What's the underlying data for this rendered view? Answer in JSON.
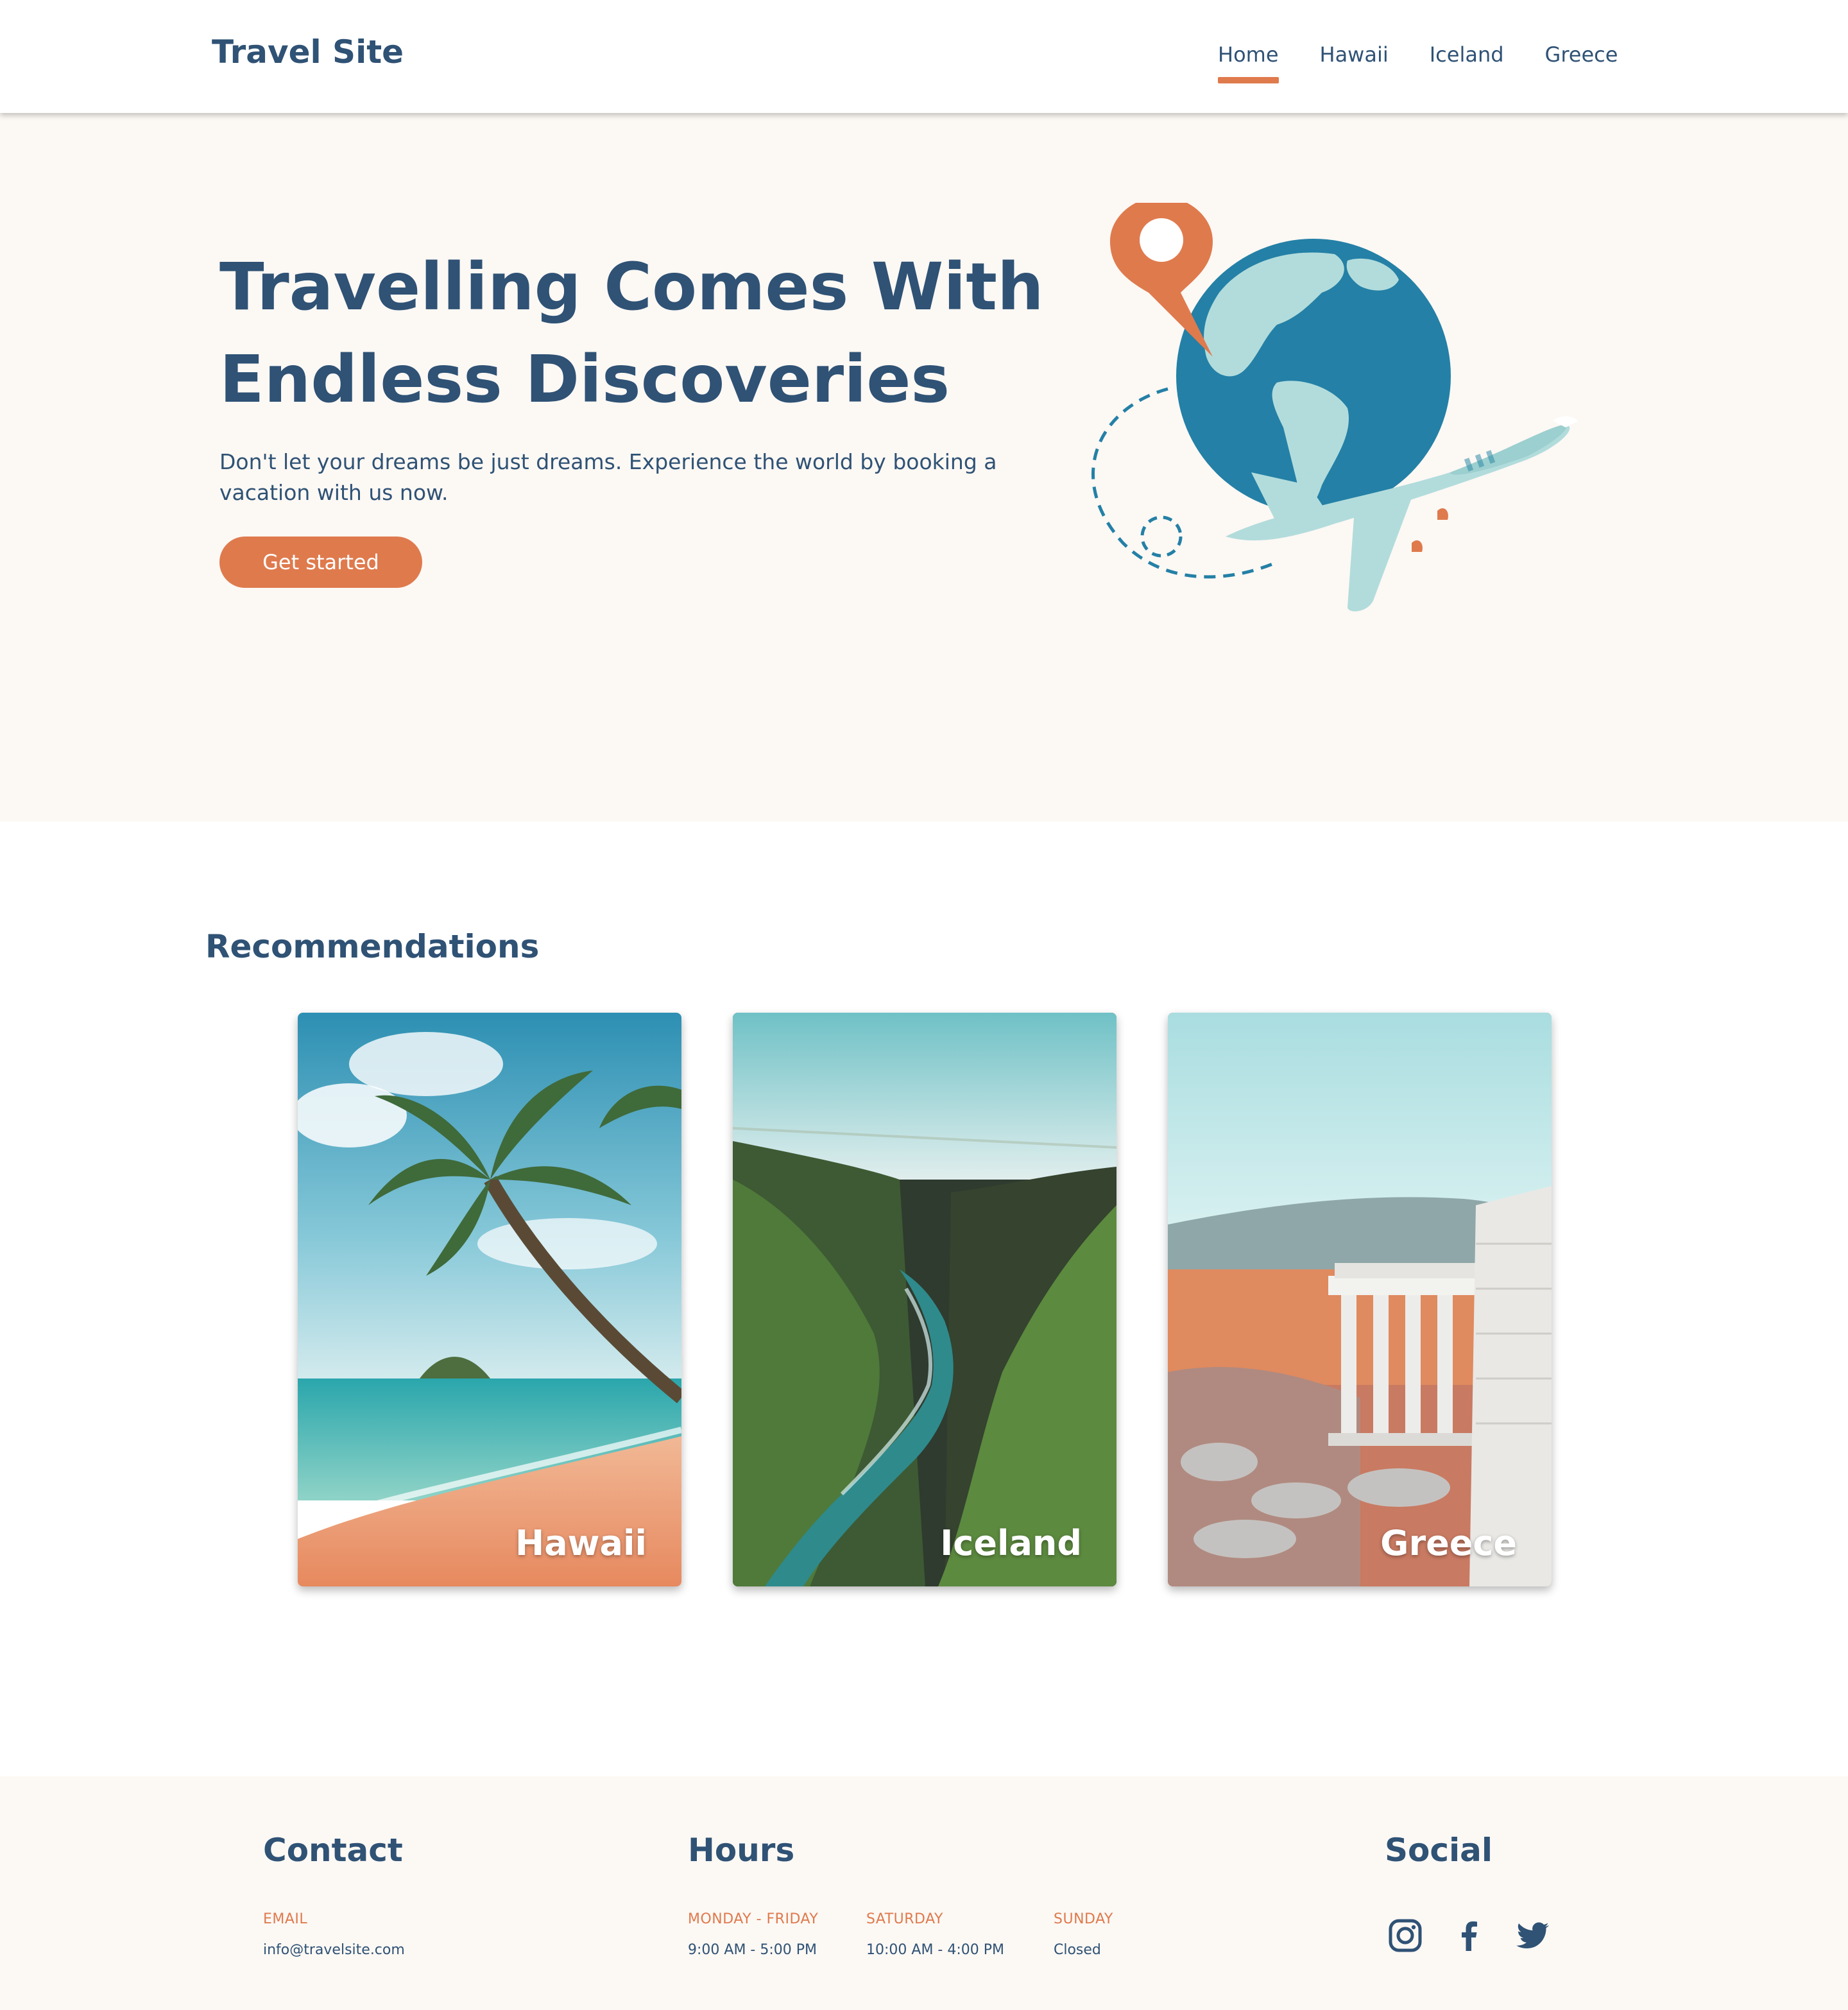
{
  "header": {
    "brand": "Travel Site",
    "nav": [
      {
        "label": "Home",
        "active": true
      },
      {
        "label": "Hawaii",
        "active": false
      },
      {
        "label": "Iceland",
        "active": false
      },
      {
        "label": "Greece",
        "active": false
      }
    ]
  },
  "hero": {
    "title_line1": "Travelling Comes With",
    "title_line2": "Endless Discoveries",
    "subtitle": "Don't let your dreams be just dreams. Experience the world by booking a vacation with us now.",
    "cta_label": "Get started"
  },
  "recommendations": {
    "title": "Recommendations",
    "cards": [
      {
        "label": "Hawaii"
      },
      {
        "label": "Iceland"
      },
      {
        "label": "Greece"
      }
    ]
  },
  "footer": {
    "contact": {
      "heading": "Contact",
      "email_label": "EMAIL",
      "email": "info@travelsite.com"
    },
    "hours": {
      "heading": "Hours",
      "weekday_label": "MONDAY - FRIDAY",
      "weekday_value": "9:00 AM - 5:00 PM",
      "saturday_label": "SATURDAY",
      "saturday_value": "10:00 AM - 4:00 PM",
      "sunday_label": "SUNDAY",
      "sunday_value": "Closed"
    },
    "social": {
      "heading": "Social",
      "icons": [
        "instagram-icon",
        "facebook-icon",
        "twitter-icon"
      ]
    }
  },
  "colors": {
    "primary": "#2f5275",
    "accent": "#df7a4d",
    "hero_bg": "#fcf8f4",
    "globe": "#2480a6",
    "land": "#b2dcdc"
  }
}
